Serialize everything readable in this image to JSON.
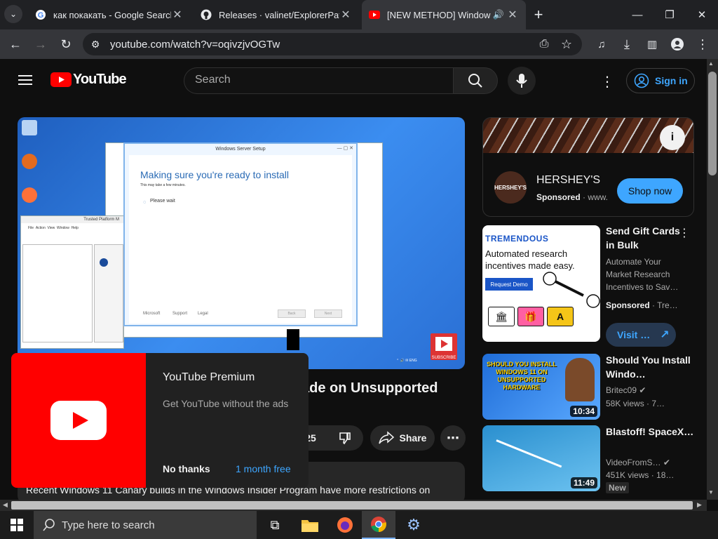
{
  "browser": {
    "tabs": [
      {
        "title": "как покакать - Google Search"
      },
      {
        "title": "Releases · valinet/ExplorerPatch"
      },
      {
        "title": "[NEW METHOD] Windows I"
      }
    ],
    "url": "youtube.com/watch?v=oqivzjvOGTw"
  },
  "youtube": {
    "logo_text": "YouTube",
    "search_placeholder": "Search",
    "sign_in": "Sign in"
  },
  "player": {
    "setup_title": "Windows Server Setup",
    "setup_heading": "Making sure you're ready to install",
    "setup_subtext": "This may take a few minutes.",
    "setup_wait": "Please wait",
    "footer_microsoft": "Microsoft",
    "footer_support": "Support",
    "footer_legal": "Legal",
    "back": "Back",
    "next": "Next",
    "tpm_title": "Trusted Platform M",
    "subscribe": "SUBSCRIBE"
  },
  "video": {
    "title_visible": "ade on Unsupported",
    "like_count_fragment": "25",
    "share_label": "Share",
    "description": "Recent Windows 11 Canary builds in the Windows Insider Program have more restrictions on"
  },
  "premium": {
    "title": "YouTube Premium",
    "subtitle": "Get YouTube without the ads",
    "no_thanks": "No thanks",
    "trial": "1 month free"
  },
  "sidebar": {
    "ad1": {
      "name": "HERSHEY'S",
      "logo": "HERSHEY'S",
      "sponsored": "Sponsored",
      "domain": "www.",
      "cta": "Shop now"
    },
    "ad2": {
      "brand": "TREMENDOUS",
      "headline": "Automated research incentives made easy.",
      "demo": "Request Demo",
      "title": "Send Gift Cards in Bulk",
      "desc": "Automate Your Market Research Incentives to Sav…",
      "sponsored": "Sponsored",
      "domain": "Tre…",
      "cta": "Visit …"
    },
    "videos": [
      {
        "title": "Should You Install Windo…",
        "channel": "Britec09",
        "views": "58K views",
        "age": "7…",
        "duration": "10:34",
        "thumb_text": "SHOULD YOU INSTALL WINDOWS 11 ON UNSUPPORTED HARDWARE"
      },
      {
        "title": "Blastoff! SpaceX…",
        "channel": "VideoFromS…",
        "views": "451K views",
        "age": "18…",
        "duration": "11:49",
        "badge": "New"
      }
    ]
  },
  "taskbar": {
    "search_placeholder": "Type here to search"
  },
  "colors": {
    "yt_red": "#ff0000",
    "link_blue": "#3ea6ff",
    "bg": "#0f0f0f"
  }
}
